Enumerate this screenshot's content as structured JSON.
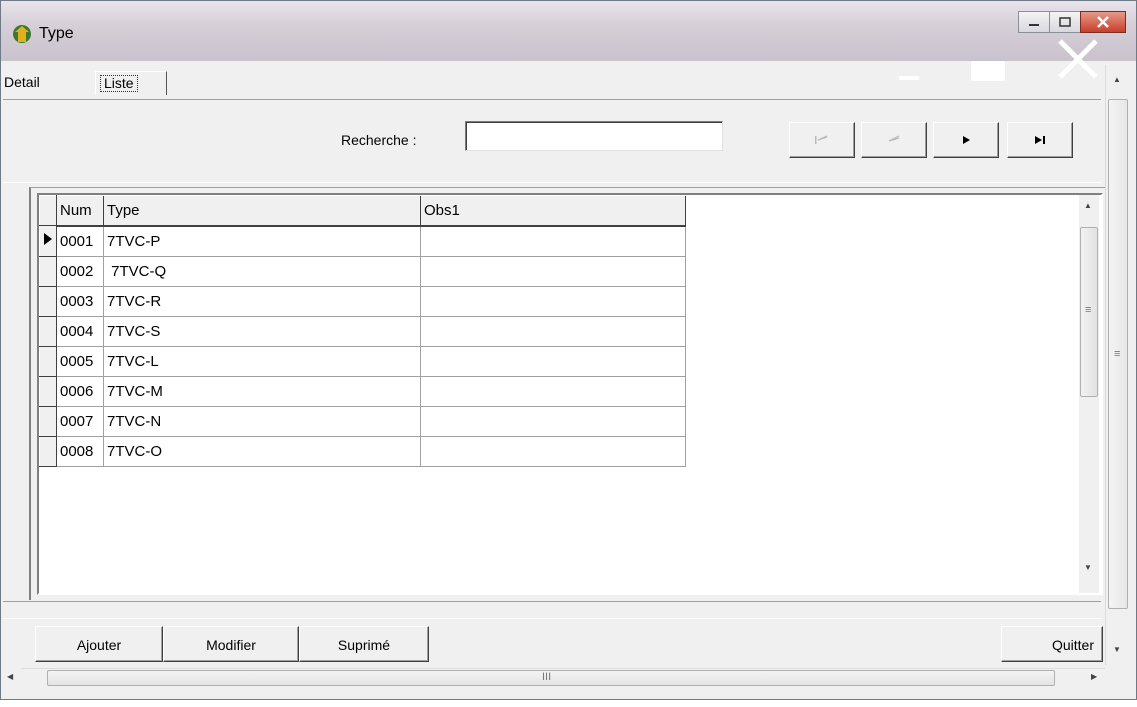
{
  "window": {
    "title": "Type"
  },
  "tabs": [
    {
      "label": "Detail"
    },
    {
      "label": "Liste"
    }
  ],
  "search": {
    "label": "Recherche :",
    "value": ""
  },
  "nav": {
    "first": "first-record-icon",
    "prev": "prev-record-icon",
    "next": "next-record-icon",
    "last": "last-record-icon"
  },
  "grid": {
    "columns": [
      "Num",
      "Type",
      "Obs1"
    ],
    "rows": [
      {
        "num": "0001",
        "type": "7TVC-P",
        "obs1": ""
      },
      {
        "num": "0002",
        "type": " 7TVC-Q",
        "obs1": ""
      },
      {
        "num": "0003",
        "type": "7TVC-R",
        "obs1": ""
      },
      {
        "num": "0004",
        "type": "7TVC-S",
        "obs1": ""
      },
      {
        "num": "0005",
        "type": "7TVC-L",
        "obs1": ""
      },
      {
        "num": "0006",
        "type": "7TVC-M",
        "obs1": ""
      },
      {
        "num": "0007",
        "type": "7TVC-N",
        "obs1": ""
      },
      {
        "num": "0008",
        "type": "7TVC-O",
        "obs1": ""
      }
    ]
  },
  "buttons": {
    "add": "Ajouter",
    "edit": "Modifier",
    "delete": "Suprimé",
    "quit": "Quitter"
  },
  "hscroll_grip": "III",
  "vscroll_grip": "≡"
}
